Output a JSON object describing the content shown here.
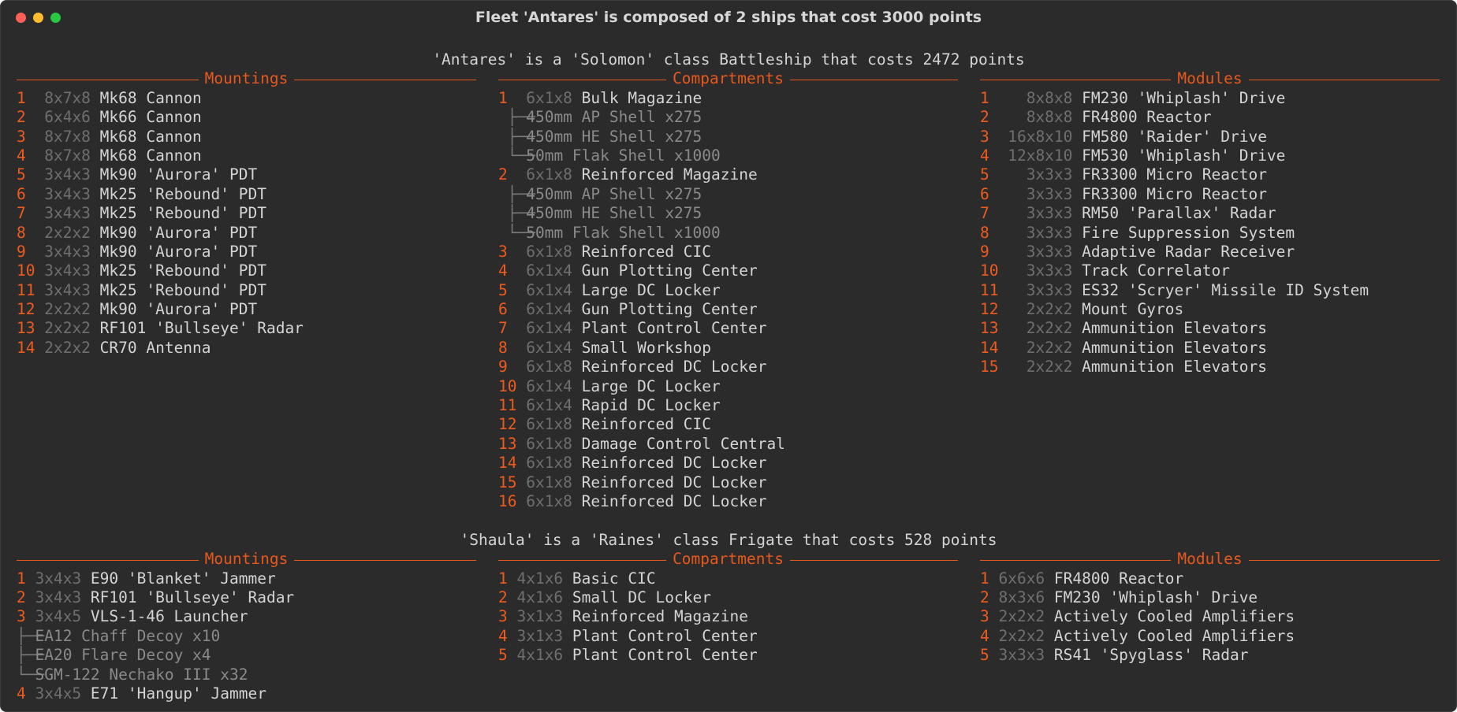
{
  "window": {
    "title": "Fleet 'Antares' is composed of 2 ships that cost 3000 points"
  },
  "colors": {
    "accent": "#e8581c",
    "dim": "#6f6f6f",
    "text": "#d4d4d4",
    "background": "#2b2b2b"
  },
  "ships": [
    {
      "header": "'Antares' is a 'Solomon' class Battleship that costs 2472 points",
      "columns": [
        {
          "title": "Mountings",
          "items": [
            {
              "num": "1",
              "size": "8x7x8",
              "name": "Mk68 Cannon"
            },
            {
              "num": "2",
              "size": "6x4x6",
              "name": "Mk66 Cannon"
            },
            {
              "num": "3",
              "size": "8x7x8",
              "name": "Mk68 Cannon"
            },
            {
              "num": "4",
              "size": "8x7x8",
              "name": "Mk68 Cannon"
            },
            {
              "num": "5",
              "size": "3x4x3",
              "name": "Mk90 'Aurora' PDT"
            },
            {
              "num": "6",
              "size": "3x4x3",
              "name": "Mk25 'Rebound' PDT"
            },
            {
              "num": "7",
              "size": "3x4x3",
              "name": "Mk25 'Rebound' PDT"
            },
            {
              "num": "8",
              "size": "2x2x2",
              "name": "Mk90 'Aurora' PDT"
            },
            {
              "num": "9",
              "size": "3x4x3",
              "name": "Mk90 'Aurora' PDT"
            },
            {
              "num": "10",
              "size": "3x4x3",
              "name": "Mk25 'Rebound' PDT"
            },
            {
              "num": "11",
              "size": "3x4x3",
              "name": "Mk25 'Rebound' PDT"
            },
            {
              "num": "12",
              "size": "2x2x2",
              "name": "Mk90 'Aurora' PDT"
            },
            {
              "num": "13",
              "size": "2x2x2",
              "name": "RF101 'Bullseye' Radar"
            },
            {
              "num": "14",
              "size": "2x2x2",
              "name": "CR70 Antenna"
            }
          ]
        },
        {
          "title": "Compartments",
          "items": [
            {
              "num": "1",
              "size": "6x1x8",
              "name": "Bulk Magazine",
              "children": [
                "450mm AP Shell x275",
                "450mm HE Shell x275",
                "50mm Flak Shell x1000"
              ]
            },
            {
              "num": "2",
              "size": "6x1x8",
              "name": "Reinforced Magazine",
              "children": [
                "450mm AP Shell x275",
                "450mm HE Shell x275",
                "50mm Flak Shell x1000"
              ]
            },
            {
              "num": "3",
              "size": "6x1x8",
              "name": "Reinforced CIC"
            },
            {
              "num": "4",
              "size": "6x1x4",
              "name": "Gun Plotting Center"
            },
            {
              "num": "5",
              "size": "6x1x4",
              "name": "Large DC Locker"
            },
            {
              "num": "6",
              "size": "6x1x4",
              "name": "Gun Plotting Center"
            },
            {
              "num": "7",
              "size": "6x1x4",
              "name": "Plant Control Center"
            },
            {
              "num": "8",
              "size": "6x1x4",
              "name": "Small Workshop"
            },
            {
              "num": "9",
              "size": "6x1x8",
              "name": "Reinforced DC Locker"
            },
            {
              "num": "10",
              "size": "6x1x4",
              "name": "Large DC Locker"
            },
            {
              "num": "11",
              "size": "6x1x4",
              "name": "Rapid DC Locker"
            },
            {
              "num": "12",
              "size": "6x1x8",
              "name": "Reinforced CIC"
            },
            {
              "num": "13",
              "size": "6x1x8",
              "name": "Damage Control Central"
            },
            {
              "num": "14",
              "size": "6x1x8",
              "name": "Reinforced DC Locker"
            },
            {
              "num": "15",
              "size": "6x1x8",
              "name": "Reinforced DC Locker"
            },
            {
              "num": "16",
              "size": "6x1x8",
              "name": "Reinforced DC Locker"
            }
          ]
        },
        {
          "title": "Modules",
          "items": [
            {
              "num": "1",
              "size": "8x8x8",
              "name": "FM230 'Whiplash' Drive"
            },
            {
              "num": "2",
              "size": "8x8x8",
              "name": "FR4800 Reactor"
            },
            {
              "num": "3",
              "size": "16x8x10",
              "name": "FM580 'Raider' Drive"
            },
            {
              "num": "4",
              "size": "12x8x10",
              "name": "FM530 'Whiplash' Drive"
            },
            {
              "num": "5",
              "size": "3x3x3",
              "name": "FR3300 Micro Reactor"
            },
            {
              "num": "6",
              "size": "3x3x3",
              "name": "FR3300 Micro Reactor"
            },
            {
              "num": "7",
              "size": "3x3x3",
              "name": "RM50 'Parallax' Radar"
            },
            {
              "num": "8",
              "size": "3x3x3",
              "name": "Fire Suppression System"
            },
            {
              "num": "9",
              "size": "3x3x3",
              "name": "Adaptive Radar Receiver"
            },
            {
              "num": "10",
              "size": "3x3x3",
              "name": "Track Correlator"
            },
            {
              "num": "11",
              "size": "3x3x3",
              "name": "ES32 'Scryer' Missile ID System"
            },
            {
              "num": "12",
              "size": "2x2x2",
              "name": "Mount Gyros"
            },
            {
              "num": "13",
              "size": "2x2x2",
              "name": "Ammunition Elevators"
            },
            {
              "num": "14",
              "size": "2x2x2",
              "name": "Ammunition Elevators"
            },
            {
              "num": "15",
              "size": "2x2x2",
              "name": "Ammunition Elevators"
            }
          ]
        }
      ]
    },
    {
      "header": "'Shaula' is a 'Raines' class Frigate that costs 528 points",
      "columns": [
        {
          "title": "Mountings",
          "items": [
            {
              "num": "1",
              "size": "3x4x3",
              "name": "E90 'Blanket' Jammer"
            },
            {
              "num": "2",
              "size": "3x4x3",
              "name": "RF101 'Bullseye' Radar"
            },
            {
              "num": "3",
              "size": "3x4x5",
              "name": "VLS-1-46 Launcher",
              "children": [
                "EA12 Chaff Decoy x10",
                "EA20 Flare Decoy x4",
                "SGM-122 Nechako III x32"
              ]
            },
            {
              "num": "4",
              "size": "3x4x5",
              "name": "E71 'Hangup' Jammer"
            }
          ]
        },
        {
          "title": "Compartments",
          "items": [
            {
              "num": "1",
              "size": "4x1x6",
              "name": "Basic CIC"
            },
            {
              "num": "2",
              "size": "4x1x6",
              "name": "Small DC Locker"
            },
            {
              "num": "3",
              "size": "3x1x3",
              "name": "Reinforced Magazine"
            },
            {
              "num": "4",
              "size": "3x1x3",
              "name": "Plant Control Center"
            },
            {
              "num": "5",
              "size": "4x1x6",
              "name": "Plant Control Center"
            }
          ]
        },
        {
          "title": "Modules",
          "items": [
            {
              "num": "1",
              "size": "6x6x6",
              "name": "FR4800 Reactor"
            },
            {
              "num": "2",
              "size": "8x3x6",
              "name": "FM230 'Whiplash' Drive"
            },
            {
              "num": "3",
              "size": "2x2x2",
              "name": "Actively Cooled Amplifiers"
            },
            {
              "num": "4",
              "size": "2x2x2",
              "name": "Actively Cooled Amplifiers"
            },
            {
              "num": "5",
              "size": "3x3x3",
              "name": "RS41 'Spyglass' Radar"
            }
          ]
        }
      ]
    }
  ]
}
